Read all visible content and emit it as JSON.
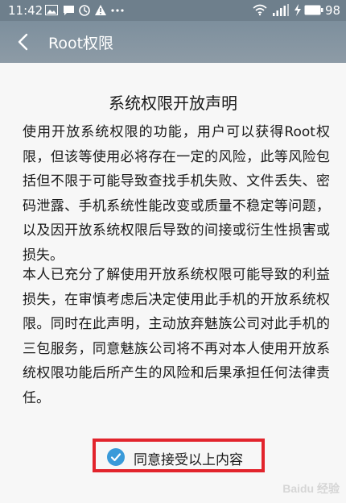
{
  "status_bar": {
    "time": "11:42",
    "battery_level": "98",
    "icons": [
      "image-icon",
      "message-icon",
      "clock-icon",
      "warning-icon",
      "more-icon",
      "wifi-icon",
      "signal-icon",
      "charging-icon",
      "battery-icon"
    ]
  },
  "app_bar": {
    "title": "Root权限",
    "back_icon": "chevron-left-icon",
    "background": "#7f919e"
  },
  "document": {
    "title": "系统权限开放声明",
    "paragraph1": "使用开放系统权限的功能，用户可以获得Root权限，但该等使用必将存在一定的风险，此等风险包括但不限于可能导致查找手机失败、文件丢失、密码泄露、手机系统性能改变或质量不稳定等问题，以及因开放系统权限后导致的间接或衍生性损害或损失。",
    "paragraph2": "本人已充分了解使用开放系统权限可能导致的利益损失，在审慎考虑后决定使用此手机的开放系统权限。同时在此声明，主动放弃魅族公司对此手机的三包服务，同意魅族公司将不再对本人使用开放系统权限功能后所产生的风险和后果承担任何法律责任。"
  },
  "agreement": {
    "label": "同意接受以上内容",
    "checked": true,
    "check_color": "#3a9ad9",
    "highlight_color": "#e2242c"
  },
  "watermark": {
    "text": "Baidu 经验"
  }
}
